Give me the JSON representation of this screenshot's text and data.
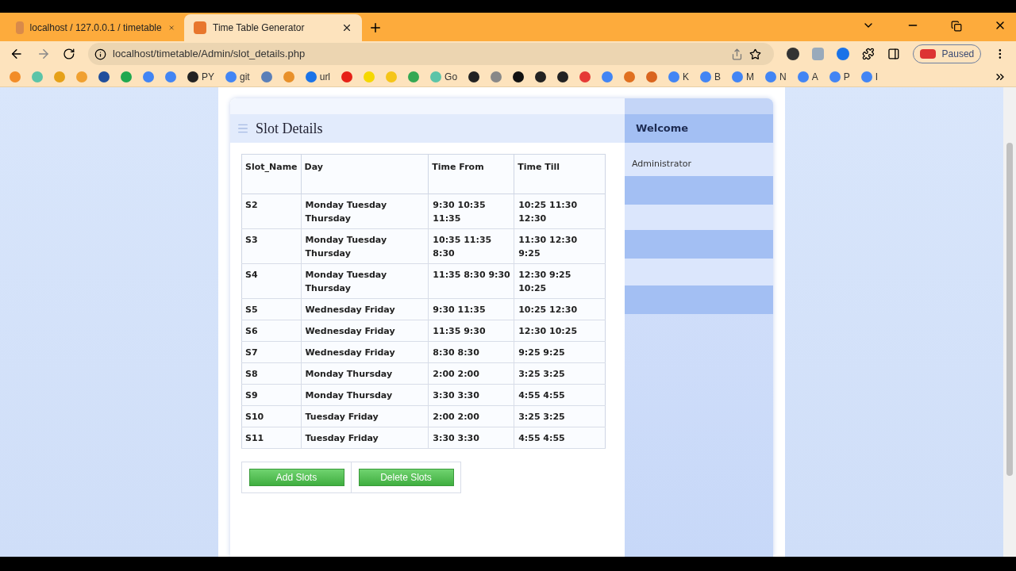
{
  "tabs": [
    {
      "title": "localhost / 127.0.0.1 / timetable",
      "selected": false
    },
    {
      "title": "Time Table Generator",
      "selected": true
    }
  ],
  "address": "localhost/timetable/Admin/slot_details.php",
  "profile": {
    "label": "Paused"
  },
  "bookmarks": [
    {
      "color": "#f28c28"
    },
    {
      "color": "#5cc4a8"
    },
    {
      "color": "#e6a118"
    },
    {
      "color": "#f0a030"
    },
    {
      "color": "#1f4e9c"
    },
    {
      "color": "#1fa84f"
    },
    {
      "color": "#4285f4"
    },
    {
      "color": "#4285f4"
    },
    {
      "color": "#222222",
      "label": "PY"
    },
    {
      "color": "#4285f4",
      "label": "git"
    },
    {
      "color": "#5a7fb8"
    },
    {
      "color": "#e8902a"
    },
    {
      "color": "#1a73e8",
      "label": "url"
    },
    {
      "color": "#e62117"
    },
    {
      "color": "#f5d800"
    },
    {
      "color": "#f5c518"
    },
    {
      "color": "#34a853"
    },
    {
      "color": "#5cc4a8",
      "label": "Go"
    },
    {
      "color": "#222222"
    },
    {
      "color": "#888888"
    },
    {
      "color": "#111111"
    },
    {
      "color": "#222222"
    },
    {
      "color": "#222222"
    },
    {
      "color": "#e53935"
    },
    {
      "color": "#4285f4"
    },
    {
      "color": "#e07020"
    },
    {
      "color": "#d9641e"
    },
    {
      "color": "#4285f4",
      "label": "K"
    },
    {
      "color": "#4285f4",
      "label": "B"
    },
    {
      "color": "#4285f4",
      "label": "M"
    },
    {
      "color": "#4285f4",
      "label": "N"
    },
    {
      "color": "#4285f4",
      "label": "A"
    },
    {
      "color": "#4285f4",
      "label": "P"
    },
    {
      "color": "#4285f4",
      "label": "I"
    }
  ],
  "heading": "Slot Details",
  "table": {
    "columns": [
      "Slot_Name",
      "Day",
      "Time From",
      "Time Till"
    ],
    "rows": [
      [
        "S2",
        "Monday Tuesday Thursday",
        "9:30 10:35 11:35",
        "10:25 11:30 12:30"
      ],
      [
        "S3",
        "Monday Tuesday Thursday",
        "10:35 11:35 8:30",
        "11:30 12:30 9:25"
      ],
      [
        "S4",
        "Monday Tuesday Thursday",
        "11:35 8:30 9:30",
        "12:30 9:25 10:25"
      ],
      [
        "S5",
        "Wednesday Friday",
        "9:30 11:35",
        "10:25 12:30"
      ],
      [
        "S6",
        "Wednesday Friday",
        "11:35 9:30",
        "12:30 10:25"
      ],
      [
        "S7",
        "Wednesday Friday",
        "8:30 8:30",
        "9:25 9:25"
      ],
      [
        "S8",
        "Monday Thursday",
        "2:00 2:00",
        "3:25 3:25"
      ],
      [
        "S9",
        "Monday Thursday",
        "3:30 3:30",
        "4:55 4:55"
      ],
      [
        "S10",
        "Tuesday Friday",
        "2:00 2:00",
        "3:25 3:25"
      ],
      [
        "S11",
        "Tuesday Friday",
        "3:30 3:30",
        "4:55 4:55"
      ]
    ]
  },
  "buttons": [
    "Add Slots",
    "Delete Slots"
  ],
  "sidebar": {
    "title": "Welcome",
    "user": "Administrator"
  }
}
